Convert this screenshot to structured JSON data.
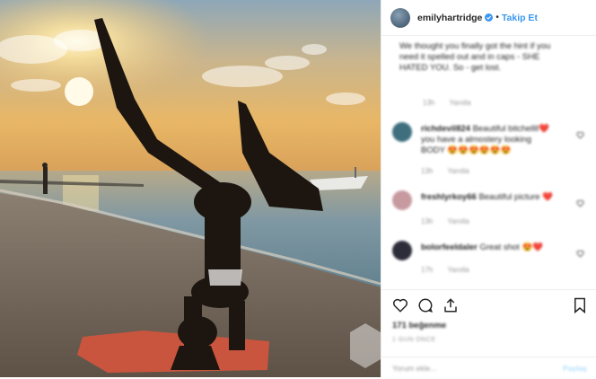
{
  "post": {
    "username": "emilyhartridge",
    "follow_label": "Takip Et",
    "separator": "•"
  },
  "caption": {
    "text": "We thought you finally got the hint if you need it spelled out and in caps - SHE HATED YOU. So - get lost.",
    "time": "13h",
    "reply": "Yanıtla"
  },
  "comments": [
    {
      "username": "richdevil824",
      "text": "Beautiful bitchellll❤️ you have a almostery looking BODY 😍😍😍😍😍😍",
      "time": "13h",
      "reply": "Yanıtla",
      "avatar_color": "#3f6f7f"
    },
    {
      "username": "freshlyrkoy66",
      "text": "Beautiful picture ❤️",
      "time": "13h",
      "reply": "Yanıtla",
      "avatar_color": "#c79aa0"
    },
    {
      "username": "bolorfeeldaler",
      "text": "Great shot 😍❤️",
      "time": "17h",
      "reply": "Yanıtla",
      "avatar_color": "#2d2d3a"
    }
  ],
  "actions": {
    "likes": "171 beğenme",
    "date": "1 GÜN ÖNCE"
  },
  "composer": {
    "placeholder": "Yorum ekle...",
    "post_label": "Paylaş"
  },
  "icons": {
    "verified": "verified-badge-icon",
    "heart": "heart-icon",
    "comment": "comment-icon",
    "share": "share-icon",
    "save": "bookmark-icon"
  },
  "colors": {
    "accent": "#3897f0",
    "text": "#262626",
    "muted": "#999999"
  }
}
